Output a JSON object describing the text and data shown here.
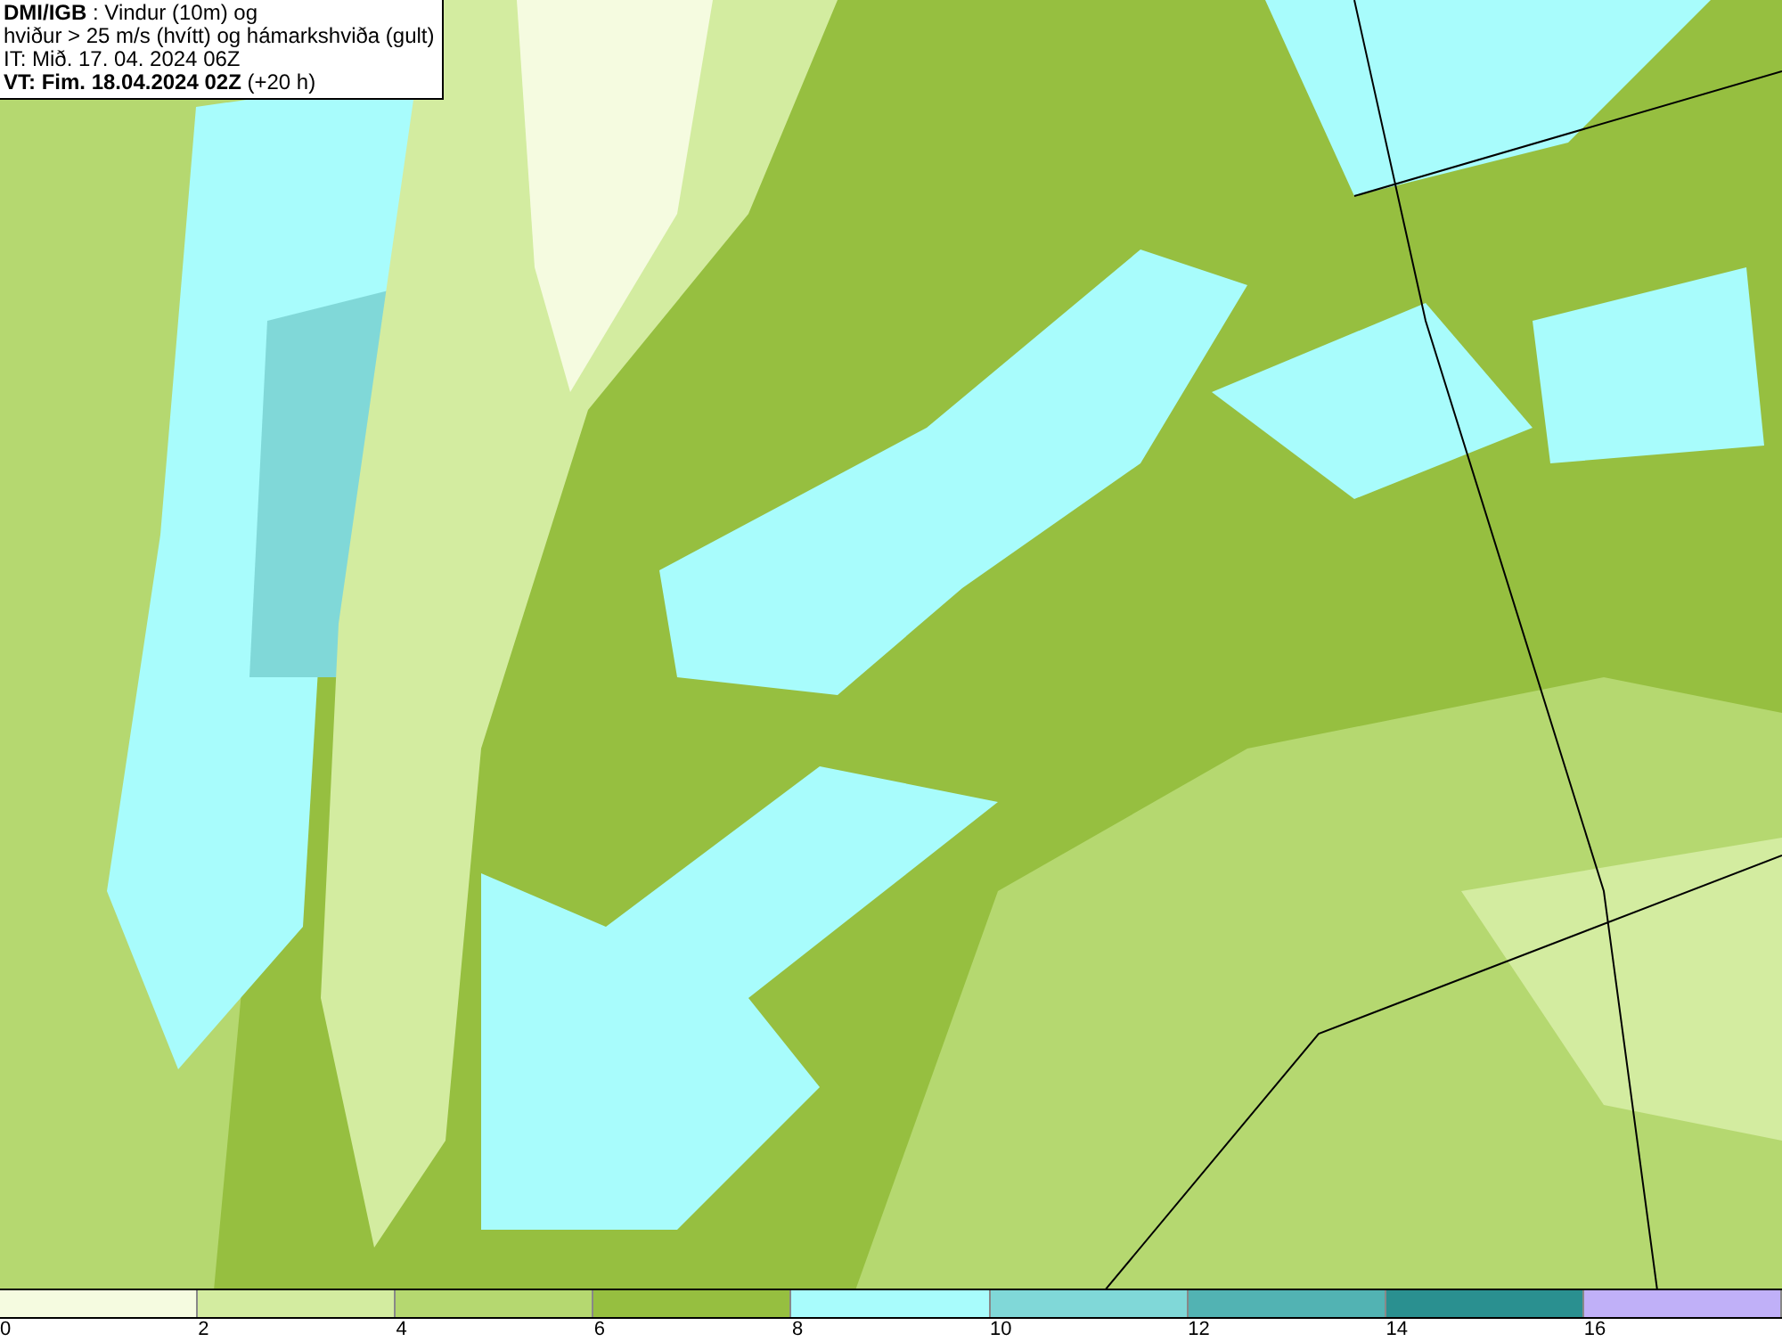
{
  "header": {
    "lines": [
      "**DMI/IGB** : Vindur (10m) og",
      "hviður > 25 m/s (hvítt) og hámarkshviða (gult)",
      "IT: Mið. 17. 04. 2024 06Z",
      "**VT: Fim. 18.04.2024 02Z** (+20 h)"
    ]
  },
  "legend": {
    "segments": [
      {
        "color": "#f5fbe0",
        "label": "0"
      },
      {
        "color": "#d3eca0",
        "label": "2"
      },
      {
        "color": "#b5d870",
        "label": "4"
      },
      {
        "color": "#96bf40",
        "label": "6"
      },
      {
        "color": "#a8fcfc",
        "label": "8"
      },
      {
        "color": "#80d8d8",
        "label": "10"
      },
      {
        "color": "#52b3b3",
        "label": "12"
      },
      {
        "color": "#2a9090",
        "label": "14"
      },
      {
        "color": "#c0b0f8",
        "label": "16"
      }
    ]
  }
}
